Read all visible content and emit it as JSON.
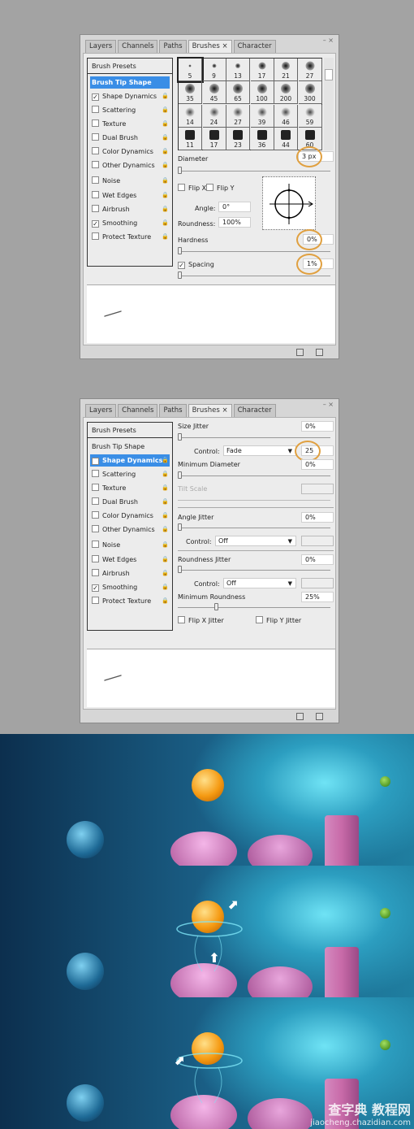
{
  "tabs": [
    "Layers",
    "Channels",
    "Paths",
    "Brushes ×",
    "Character"
  ],
  "window_controls": "– ×",
  "panel1": {
    "list": [
      {
        "label": "Brush Presets",
        "type": "header"
      },
      {
        "label": "Brush Tip Shape",
        "type": "selected"
      },
      {
        "label": "Shape Dynamics",
        "checked": true,
        "lock": true
      },
      {
        "label": "Scattering",
        "checked": false,
        "lock": true
      },
      {
        "label": "Texture",
        "checked": false,
        "lock": true
      },
      {
        "label": "Dual Brush",
        "checked": false,
        "lock": true
      },
      {
        "label": "Color Dynamics",
        "checked": false,
        "lock": true
      },
      {
        "label": "Other Dynamics",
        "checked": false,
        "lock": true
      },
      {
        "label": "Noise",
        "checked": false,
        "lock": true
      },
      {
        "label": "Wet Edges",
        "checked": false,
        "lock": true
      },
      {
        "label": "Airbrush",
        "checked": false,
        "lock": true
      },
      {
        "label": "Smoothing",
        "checked": true,
        "lock": true
      },
      {
        "label": "Protect Texture",
        "checked": false,
        "lock": true
      }
    ],
    "brush_sizes": [
      "5",
      "9",
      "13",
      "17",
      "21",
      "27",
      "35",
      "45",
      "65",
      "100",
      "200",
      "300",
      "14",
      "24",
      "27",
      "39",
      "46",
      "59",
      "11",
      "17",
      "23",
      "36",
      "44",
      "60"
    ],
    "diameter_label": "Diameter",
    "diameter_value": "3 px",
    "flip_x": "Flip X",
    "flip_y": "Flip Y",
    "angle_label": "Angle:",
    "angle_value": "0°",
    "roundness_label": "Roundness:",
    "roundness_value": "100%",
    "hardness_label": "Hardness",
    "hardness_value": "0%",
    "spacing_label": "Spacing",
    "spacing_checked": true,
    "spacing_value": "1%"
  },
  "panel2": {
    "list": [
      {
        "label": "Brush Presets",
        "type": "header"
      },
      {
        "label": "Brush Tip Shape",
        "type": "plain"
      },
      {
        "label": "Shape Dynamics",
        "checked": true,
        "lock": true,
        "type": "selected"
      },
      {
        "label": "Scattering",
        "checked": false,
        "lock": true
      },
      {
        "label": "Texture",
        "checked": false,
        "lock": true
      },
      {
        "label": "Dual Brush",
        "checked": false,
        "lock": true
      },
      {
        "label": "Color Dynamics",
        "checked": false,
        "lock": true
      },
      {
        "label": "Other Dynamics",
        "checked": false,
        "lock": true
      },
      {
        "label": "Noise",
        "checked": false,
        "lock": true
      },
      {
        "label": "Wet Edges",
        "checked": false,
        "lock": true
      },
      {
        "label": "Airbrush",
        "checked": false,
        "lock": true
      },
      {
        "label": "Smoothing",
        "checked": true,
        "lock": true
      },
      {
        "label": "Protect Texture",
        "checked": false,
        "lock": true
      }
    ],
    "size_jitter_label": "Size Jitter",
    "size_jitter_value": "0%",
    "control_label": "Control:",
    "size_control": "Fade",
    "fade_steps": "25",
    "min_diameter_label": "Minimum Diameter",
    "min_diameter_value": "0%",
    "tilt_scale_label": "Tilt Scale",
    "angle_jitter_label": "Angle Jitter",
    "angle_jitter_value": "0%",
    "angle_control": "Off",
    "roundness_jitter_label": "Roundness Jitter",
    "roundness_jitter_value": "0%",
    "roundness_control": "Off",
    "min_roundness_label": "Minimum Roundness",
    "min_roundness_value": "25%",
    "flip_x_jitter": "Flip X Jitter",
    "flip_y_jitter": "Flip Y Jitter"
  },
  "colors": {
    "highlight": "#3a8ee6",
    "annotation_ring": "#e0a040",
    "orb": "#f59a12",
    "pillar": "#c86aa8"
  },
  "watermark": {
    "line1": "查字典 教程网",
    "line2": "jiaocheng.chazidian.com"
  }
}
